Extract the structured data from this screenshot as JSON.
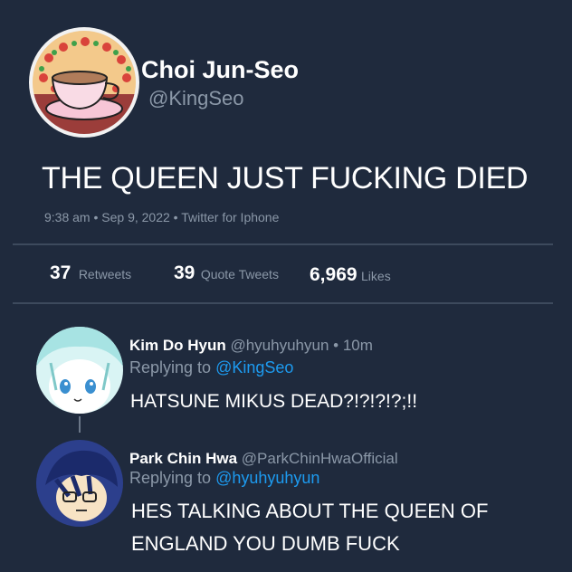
{
  "tweet": {
    "display_name": "Choi Jun-Seo",
    "handle": "@KingSeo",
    "text": "THE QUEEN JUST FUCKING DIED",
    "meta": "9:38 am • Sep 9, 2022 • Twitter for Iphone",
    "avatar_icon": "teacup-icon"
  },
  "stats": {
    "retweets_count": "37",
    "retweets_label": "Retweets",
    "quotes_count": "39",
    "quotes_label": "Quote Tweets",
    "likes_count": "6,969",
    "likes_label": "Likes"
  },
  "replies": [
    {
      "display_name": "Kim Do Hyun",
      "handle": "@hyuhyuhyun",
      "time": "• 10m",
      "replying_prefix": "Replying to",
      "replying_to": "@KingSeo",
      "text": "HATSUNE MIKUS DEAD?!?!?!?;!!"
    },
    {
      "display_name": "Park Chin Hwa",
      "handle": "@ParkChinHwaOfficial",
      "replying_prefix": "Replying to",
      "replying_to": "@hyuhyuhyun",
      "text_line1": "HES TALKING ABOUT THE QUEEN OF",
      "text_line2": "ENGLAND YOU DUMB FUCK"
    }
  ],
  "colors": {
    "background": "#1f2a3d",
    "muted": "#8b98a8",
    "link": "#1d9bf0"
  }
}
